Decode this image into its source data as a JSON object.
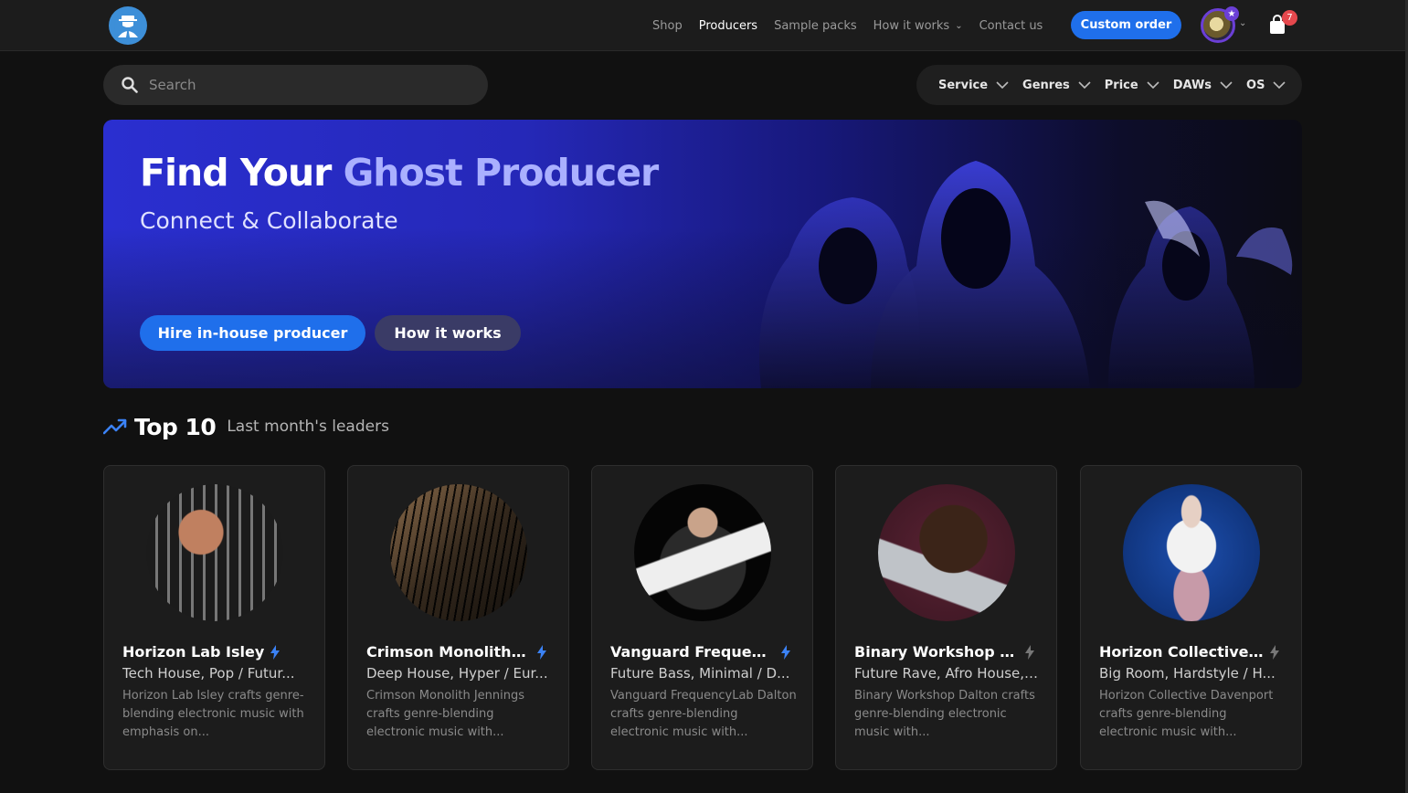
{
  "nav": {
    "items": [
      {
        "label": "Shop",
        "active": false
      },
      {
        "label": "Producers",
        "active": true
      },
      {
        "label": "Sample packs",
        "active": false
      },
      {
        "label": "How it works",
        "active": false,
        "dropdown": true
      },
      {
        "label": "Contact us",
        "active": false
      }
    ],
    "custom_order_label": "Custom order",
    "cart_count": "7",
    "icons": {
      "logo": "ghost-producer-logo-icon",
      "cart": "shopping-bag-icon",
      "avatar_badge": "star-icon"
    }
  },
  "search": {
    "placeholder": "Search"
  },
  "filters": [
    "Service",
    "Genres",
    "Price",
    "DAWs",
    "OS"
  ],
  "hero": {
    "title_main": "Find Your ",
    "title_accent": "Ghost Producer",
    "subtitle": "Connect & Collaborate",
    "primary_button": "Hire in-house producer",
    "secondary_button": "How it works"
  },
  "top10": {
    "title": "Top 10",
    "subtitle": "Last month's leaders"
  },
  "cards": [
    {
      "name": "Horizon Lab Isley",
      "genres": "Tech House, Pop / Futur...",
      "description": "Horizon Lab Isley crafts genre-blending electronic music with emphasis on...",
      "featured": true
    },
    {
      "name": "Crimson Monolith Je...",
      "genres": "Deep House, Hyper / Eur...",
      "description": "Crimson Monolith Jennings crafts genre-blending electronic music with...",
      "featured": true
    },
    {
      "name": "Vanguard Frequency...",
      "genres": "Future Bass, Minimal / D...",
      "description": "Vanguard FrequencyLab Dalton crafts genre-blending electronic music with...",
      "featured": true
    },
    {
      "name": "Binary Workshop Dal...",
      "genres": "Future Rave, Afro House, ...",
      "description": "Binary Workshop Dalton crafts genre-blending electronic music with...",
      "featured": false
    },
    {
      "name": "Horizon Collective Da...",
      "genres": "Big Room, Hardstyle / H...",
      "description": "Horizon Collective Davenport crafts genre-blending electronic music with...",
      "featured": false
    }
  ],
  "colors": {
    "accent": "#1f6feb",
    "hero_accent_text": "#aab0ff",
    "badge": "#e5484d",
    "avatar_ring": "#6b3fd6"
  }
}
